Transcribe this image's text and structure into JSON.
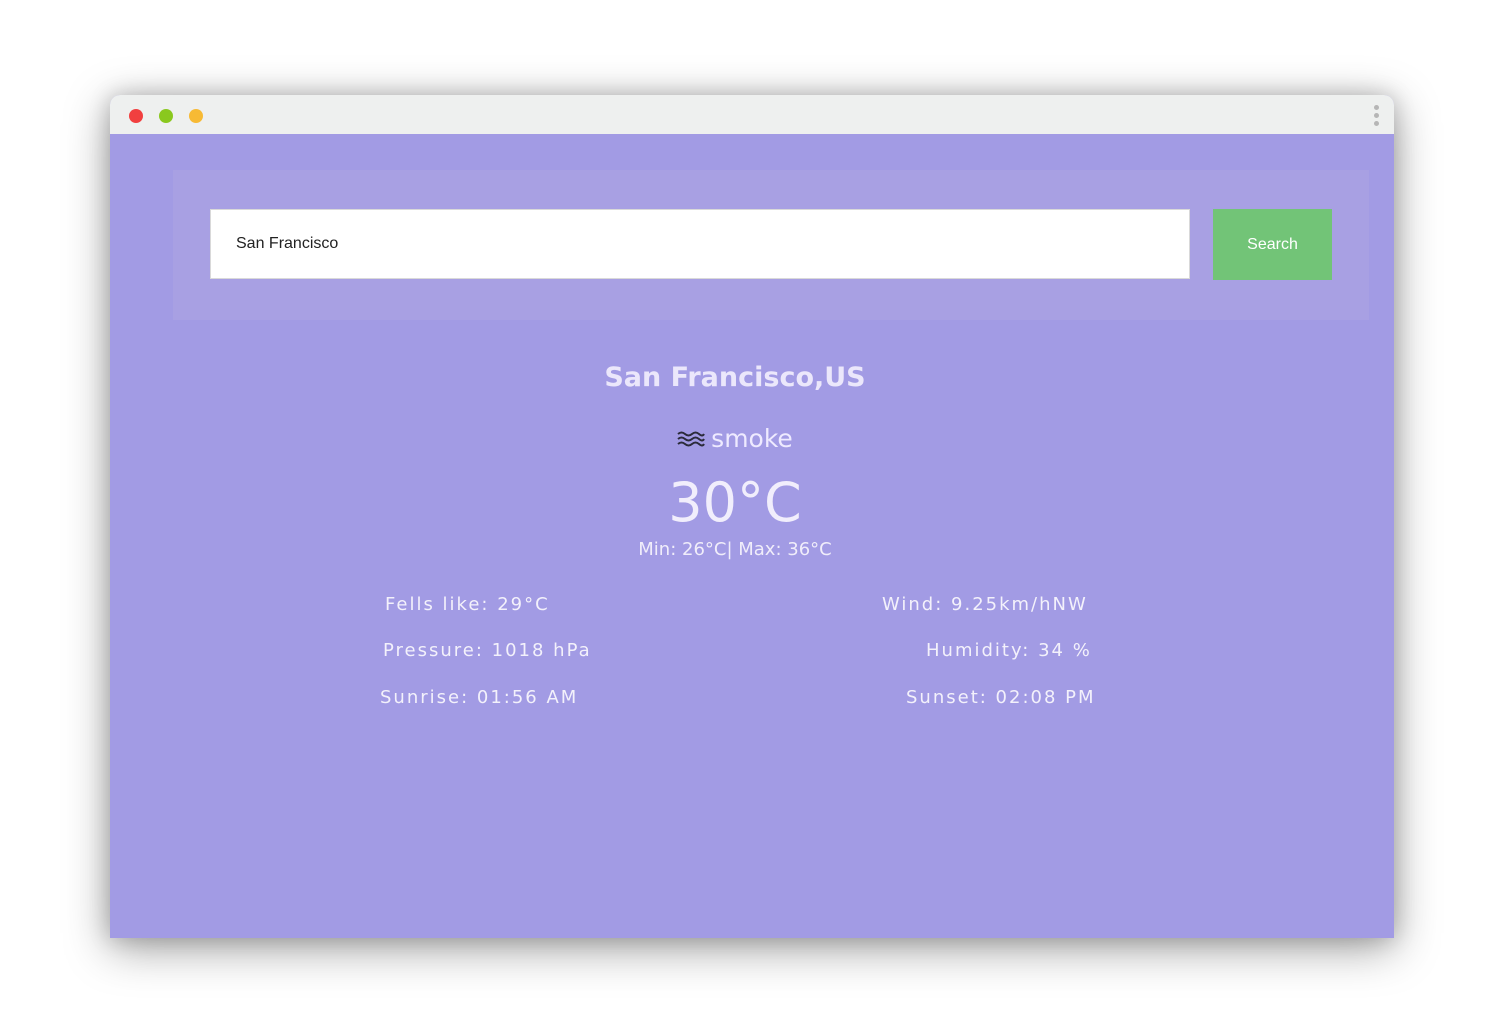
{
  "window": {
    "traffic_lights": [
      {
        "name": "close",
        "color": "#f13f3f"
      },
      {
        "name": "minimize",
        "color": "#8ac81e"
      },
      {
        "name": "zoom",
        "color": "#f7ba34"
      }
    ]
  },
  "search": {
    "value": "San Francisco",
    "button_label": "Search"
  },
  "weather": {
    "location": "San Francisco,US",
    "condition_icon": "smoke-waves-icon",
    "condition": "smoke",
    "temperature": "30°C",
    "min_max": "Min: 26°C| Max: 36°C"
  },
  "details": {
    "feels_like": "Fells like: 29°C",
    "wind": "Wind: 9.25km/hNW",
    "pressure": "Pressure: 1018 hPa",
    "humidity": "Humidity: 34 %",
    "sunrise": "Sunrise: 01:56 AM",
    "sunset": "Sunset: 02:08 PM"
  },
  "colors": {
    "background": "#a29be4",
    "panel": "#a8a0e3",
    "search_button": "#72c477",
    "titlebar": "#eef0ef"
  }
}
